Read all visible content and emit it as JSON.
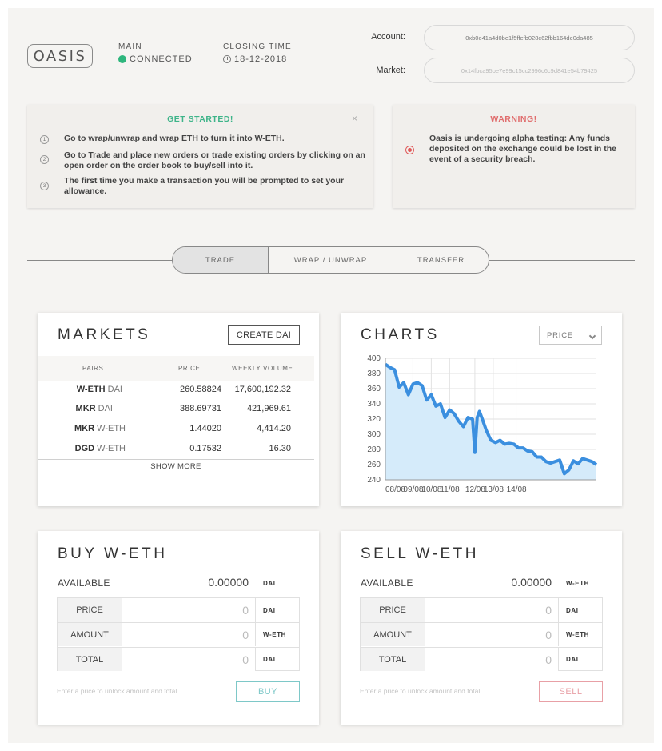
{
  "header": {
    "logo": "OASIS",
    "network_label": "MAIN",
    "network_status": "CONNECTED",
    "closing_label": "CLOSING TIME",
    "closing_date": "18-12-2018",
    "account_label": "Account:",
    "account_value": "0xb0e41a4d0be1f5ffefb028c62fbb164de0da485",
    "market_label": "Market:",
    "market_value": "0x14fbca95be7e99c15cc2996c6c9d841e54b79425"
  },
  "get_started": {
    "title": "GET STARTED!",
    "close": "×",
    "steps": [
      {
        "num": "1",
        "text": "Go to wrap/unwrap and wrap ETH to turn it into W-ETH."
      },
      {
        "num": "2",
        "text": "Go to Trade and place new orders or trade existing orders by clicking on an open order on the order book to buy/sell into it."
      },
      {
        "num": "3",
        "text": "The first time you make a transaction you will be prompted to set your allowance."
      }
    ]
  },
  "warning": {
    "title": "WARNING!",
    "text": "Oasis is undergoing alpha testing: Any funds deposited on the exchange could be lost in the event of a security breach."
  },
  "tabs": [
    "TRADE",
    "WRAP / UNWRAP",
    "TRANSFER"
  ],
  "markets": {
    "title": "MARKETS",
    "create_button": "CREATE DAI",
    "columns": [
      "PAIRS",
      "PRICE",
      "WEEKLY VOLUME"
    ],
    "rows": [
      {
        "base": "W-ETH",
        "quote": "DAI",
        "price": "260.58824",
        "volume": "17,600,192.32"
      },
      {
        "base": "MKR",
        "quote": "DAI",
        "price": "388.69731",
        "volume": "421,969.61"
      },
      {
        "base": "MKR",
        "quote": "W-ETH",
        "price": "1.44020",
        "volume": "4,414.20"
      },
      {
        "base": "DGD",
        "quote": "W-ETH",
        "price": "0.17532",
        "volume": "16.30"
      }
    ],
    "show_more": "SHOW MORE"
  },
  "charts": {
    "title": "CHARTS",
    "select_value": "PRICE",
    "colors": {
      "line": "#3b8fdf",
      "fill": "#d5ebfa",
      "grid": "#e2e2e2"
    }
  },
  "chart_data": {
    "type": "area",
    "title": "",
    "xlabel": "",
    "ylabel": "",
    "ylim": [
      240,
      400
    ],
    "yticks": [
      240,
      260,
      280,
      300,
      320,
      340,
      360,
      380,
      400
    ],
    "xtick_labels": [
      "08/08",
      "09/08",
      "10/08",
      "11/08",
      "12/08",
      "13/08",
      "14/08"
    ],
    "xtick_pos": [
      0.0,
      0.6,
      1.0,
      1.4,
      1.95,
      2.35,
      2.85
    ],
    "x_range": [
      0,
      4.6
    ],
    "grid": true,
    "series": [
      {
        "x": [
          0.0,
          0.1,
          0.2,
          0.3,
          0.4,
          0.5,
          0.6,
          0.7,
          0.8,
          0.9,
          1.0,
          1.1,
          1.2,
          1.3,
          1.4,
          1.5,
          1.6,
          1.7,
          1.8,
          1.9,
          1.95,
          2.0,
          2.05,
          2.1,
          2.2,
          2.3,
          2.4,
          2.5,
          2.6,
          2.7,
          2.8,
          2.9,
          3.0,
          3.1,
          3.2,
          3.3,
          3.4,
          3.5,
          3.6,
          3.7,
          3.8,
          3.9,
          4.0,
          4.1,
          4.2,
          4.3,
          4.4,
          4.5,
          4.6
        ],
        "values": [
          392,
          388,
          385,
          362,
          368,
          352,
          366,
          368,
          364,
          345,
          352,
          337,
          340,
          322,
          332,
          327,
          317,
          310,
          322,
          320,
          276,
          322,
          330,
          322,
          305,
          292,
          289,
          292,
          287,
          288,
          287,
          282,
          282,
          278,
          277,
          270,
          270,
          264,
          262,
          264,
          266,
          248,
          253,
          265,
          261,
          268,
          266,
          264,
          260
        ]
      }
    ]
  },
  "buy": {
    "title": "BUY W-ETH",
    "available_label": "AVAILABLE",
    "available_value": "0.00000",
    "available_unit": "DAI",
    "rows": [
      {
        "label": "PRICE",
        "value": "0",
        "unit": "DAI"
      },
      {
        "label": "AMOUNT",
        "value": "0",
        "unit": "W-ETH"
      },
      {
        "label": "TOTAL",
        "value": "0",
        "unit": "DAI"
      }
    ],
    "hint": "Enter a price to unlock amount and total.",
    "button": "BUY",
    "button_color": "#7ec8c8"
  },
  "sell": {
    "title": "SELL W-ETH",
    "available_label": "AVAILABLE",
    "available_value": "0.00000",
    "available_unit": "W-ETH",
    "rows": [
      {
        "label": "PRICE",
        "value": "0",
        "unit": "DAI"
      },
      {
        "label": "AMOUNT",
        "value": "0",
        "unit": "W-ETH"
      },
      {
        "label": "TOTAL",
        "value": "0",
        "unit": "DAI"
      }
    ],
    "hint": "Enter a price to unlock amount and total.",
    "button": "SELL",
    "button_color": "#e8a0a6"
  }
}
